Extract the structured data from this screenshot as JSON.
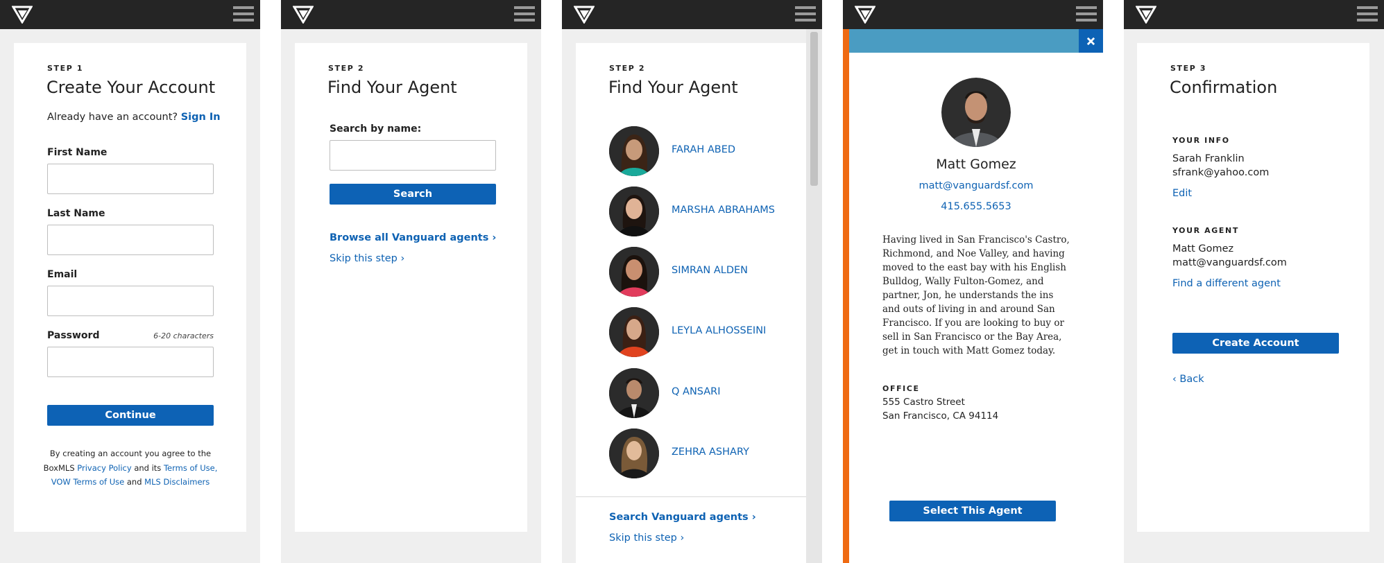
{
  "screen1": {
    "step": "STEP 1",
    "title": "Create Your Account",
    "already": "Already have an account?",
    "sign_in": "Sign In",
    "first_name": "First Name",
    "last_name": "Last Name",
    "email": "Email",
    "password": "Password",
    "password_hint": "6-20 characters",
    "continue": "Continue",
    "legal_1": "By creating an account you agree to the BoxMLS",
    "privacy": "Privacy Policy",
    "and_its": "and its",
    "terms": "Terms of Use,",
    "vow_terms": "VOW Terms of Use",
    "and": "and",
    "mls": "MLS Disclaimers"
  },
  "screen2": {
    "step": "STEP 2",
    "title": "Find Your Agent",
    "search_label": "Search by name:",
    "search_button": "Search",
    "browse": "Browse all Vanguard agents ›",
    "skip": "Skip this step ›"
  },
  "screen3": {
    "step": "STEP 2",
    "title": "Find Your Agent",
    "agents": [
      "FARAH ABED",
      "MARSHA ABRAHAMS",
      "SIMRAN ALDEN",
      "LEYLA ALHOSSEINI",
      "Q ANSARI",
      "ZEHRA ASHARY"
    ],
    "search_link": "Search Vanguard agents ›",
    "skip": "Skip this step ›"
  },
  "screen4": {
    "name": "Matt Gomez",
    "email": "matt@vanguardsf.com",
    "phone": "415.655.5653",
    "bio": "Having lived in San Francisco's Castro, Richmond, and Noe Valley, and having moved to the east bay with his English Bulldog, Wally Fulton-Gomez, and partner, Jon, he understands the ins and outs of living in and around San Francisco. If you are looking to buy or sell in San Francisco or the Bay Area, get in touch with Matt Gomez today.",
    "office_label": "OFFICE",
    "office_line1": "555 Castro Street",
    "office_line2": "San Francisco, CA 94114",
    "select": "Select This Agent"
  },
  "screen5": {
    "step": "STEP 3",
    "title": "Confirmation",
    "your_info": "YOUR INFO",
    "user_name": "Sarah Franklin",
    "user_email": "sfrank@yahoo.com",
    "edit": "Edit",
    "your_agent": "YOUR AGENT",
    "agent_name": "Matt Gomez",
    "agent_email": "matt@vanguardsf.com",
    "find_different": "Find a different agent",
    "create": "Create Account",
    "back": "‹ Back"
  },
  "colors": {
    "topbar": "#252525",
    "link": "#0e62b3",
    "button": "#0d62b5",
    "modal_header": "#4a9cc2",
    "modal_accent": "#ef6a12"
  },
  "icons": [
    "logo-icon",
    "hamburger-menu-icon",
    "close-icon"
  ]
}
